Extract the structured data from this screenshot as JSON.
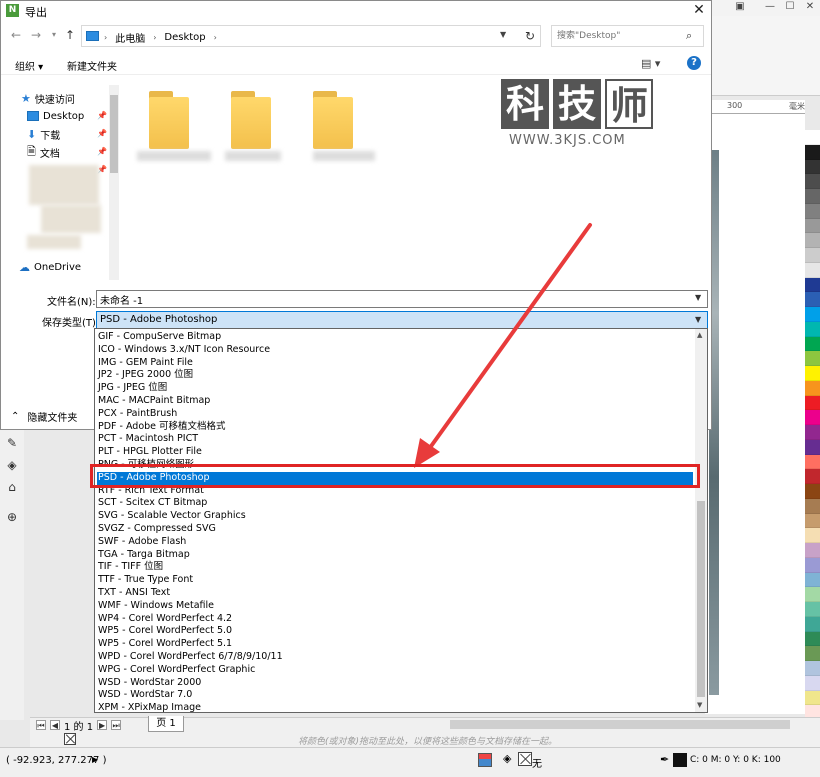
{
  "dialog": {
    "title": "导出",
    "app_icon_glyph": "N",
    "close_glyph": "✕"
  },
  "address": {
    "crumbs": [
      "此电脑",
      "Desktop"
    ],
    "search_placeholder": "搜索\"Desktop\""
  },
  "toolbar": {
    "organize_label": "组织 ▾",
    "new_folder_label": "新建文件夹"
  },
  "nav_pane": {
    "items": [
      {
        "label": "快速访问",
        "icon": "star-icon"
      },
      {
        "label": "Desktop",
        "icon": "desktop-icon"
      },
      {
        "label": "下载",
        "icon": "download-icon"
      },
      {
        "label": "文档",
        "icon": "document-icon"
      },
      {
        "label": "OneDrive",
        "icon": "cloud-icon"
      }
    ]
  },
  "watermark": {
    "chars": [
      "科",
      "技",
      "师"
    ],
    "url": "WWW.3KJS.COM"
  },
  "form": {
    "filename_label": "文件名(N):",
    "filename_value": "未命名 -1",
    "type_label": "保存类型(T):",
    "type_value": "PSD - Adobe Photoshop",
    "hide_folders_label": "隐藏文件夹"
  },
  "file_types": {
    "selected_index": 11,
    "options": [
      "GIF - CompuServe Bitmap",
      "ICO - Windows 3.x/NT Icon Resource",
      "IMG - GEM Paint File",
      "JP2 - JPEG 2000 位图",
      "JPG - JPEG 位图",
      "MAC - MACPaint Bitmap",
      "PCX - PaintBrush",
      "PDF - Adobe 可移植文档格式",
      "PCT - Macintosh PICT",
      "PLT - HPGL Plotter File",
      "PNG - 可移植网络图形",
      "PSD - Adobe Photoshop",
      "RTF - Rich Text Format",
      "SCT - Scitex CT Bitmap",
      "SVG - Scalable Vector Graphics",
      "SVGZ - Compressed SVG",
      "SWF - Adobe Flash",
      "TGA - Targa Bitmap",
      "TIF - TIFF 位图",
      "TTF - True Type Font",
      "TXT - ANSI Text",
      "WMF - Windows Metafile",
      "WP4 - Corel WordPerfect 4.2",
      "WP5 - Corel WordPerfect 5.0",
      "WP5 - Corel WordPerfect 5.1",
      "WPD - Corel WordPerfect 6/7/8/9/10/11",
      "WPG - Corel WordPerfect Graphic",
      "WSD - WordStar 2000",
      "WSD - WordStar 7.0",
      "XPM - XPixMap Image"
    ]
  },
  "background_app": {
    "ruler_labels": [
      "300",
      "毫米"
    ],
    "page_counter": "1 的 1",
    "page_tab": "页 1",
    "hint_text": "将颜色(或对象)拖动至此处，以便将这些颜色与文档存储在一起。",
    "coords": "( -92.923, 277.277 )",
    "fill_none_label": "无",
    "cmyk_label": "C: 0 M: 0 Y: 0 K: 100",
    "palette_colors": [
      "#ffffff",
      "#1a1a1a",
      "#333333",
      "#4d4d4d",
      "#666666",
      "#808080",
      "#999999",
      "#b3b3b3",
      "#cccccc",
      "#e6e6e6",
      "#1f3a93",
      "#2b5fb4",
      "#00a0e9",
      "#00b7b0",
      "#00a651",
      "#8dc63f",
      "#fff200",
      "#f7941d",
      "#ed1c24",
      "#ec008c",
      "#92278f",
      "#662d91",
      "#ff6f61",
      "#c1272d",
      "#8b4513",
      "#a67c52",
      "#c69c6d",
      "#f5deb3",
      "#c8a2c8",
      "#9a9ad4",
      "#7fb3d5",
      "#a3d9a5",
      "#66c2a5",
      "#3fa796",
      "#2e8b57",
      "#6a9955",
      "#b0c4de",
      "#d8d8f0",
      "#f0e68c",
      "#ffe4e1"
    ]
  }
}
